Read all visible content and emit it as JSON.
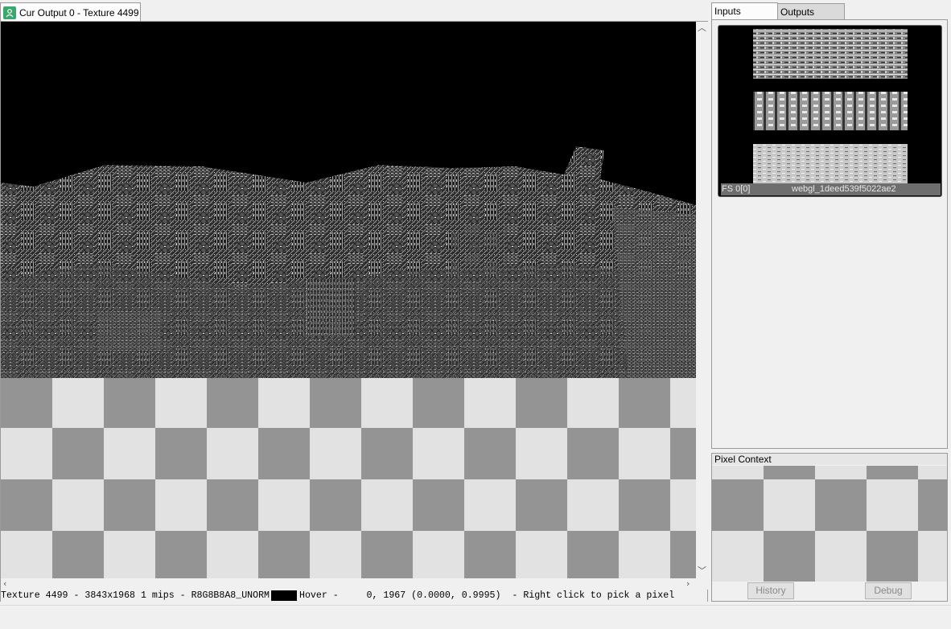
{
  "doc_tab": {
    "label": "Cur Output 0 - Texture 4499",
    "icon": "person-icon"
  },
  "status": {
    "texture": "Texture 4499",
    "dims": "3843x1968 1 mips",
    "format": "R8G8B8A8_UNORM",
    "hover_label": "Hover -",
    "hover_value": "0, 1967 (0.0000, 0.9995)",
    "hint": "Right click to pick a pixel"
  },
  "right_tabs": {
    "inputs": "Inputs",
    "outputs": "Outputs"
  },
  "input_thumb": {
    "slot": "FS 0[0]",
    "name": "webgl_1deed539f5022ae2"
  },
  "pixel_context": {
    "title": "Pixel Context",
    "history": "History",
    "debug": "Debug"
  },
  "colors": {
    "checker_light": "#e2e2e2",
    "checker_dark": "#949494",
    "tab_icon": "#3aa86b"
  }
}
